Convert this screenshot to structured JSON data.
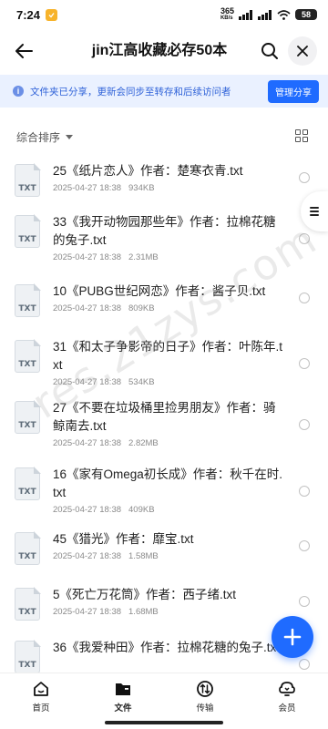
{
  "status_bar": {
    "time": "7:24",
    "speed_top": "365",
    "speed_unit": "KB/s",
    "battery": "58"
  },
  "title_bar": {
    "title": "jin江高收藏必存50本"
  },
  "banner": {
    "text": "文件夹已分享，更新会同步至转存和后续访问者",
    "manage_label": "管理分享",
    "colors": {
      "background": "#eaf1ff",
      "text": "#2f62d8",
      "button": "#1f6bff"
    }
  },
  "toolbar": {
    "sort_label": "综合排序"
  },
  "files": [
    {
      "ext": "TXT",
      "name": "25《纸片恋人》作者：楚寒衣青.txt",
      "date": "2025-04-27 18:38",
      "size": "934KB"
    },
    {
      "ext": "TXT",
      "name": "33《我开动物园那些年》作者：拉棉花糖的兔子.txt",
      "date": "2025-04-27 18:38",
      "size": "2.31MB"
    },
    {
      "ext": "TXT",
      "name": "10《PUBG世纪网恋》作者：酱子贝.txt",
      "date": "2025-04-27 18:38",
      "size": "809KB"
    },
    {
      "ext": "TXT",
      "name": "31《和太子争影帝的日子》作者：叶陈年.txt",
      "date": "2025-04-27 18:38",
      "size": "534KB"
    },
    {
      "ext": "TXT",
      "name": "27《不要在垃圾桶里捡男朋友》作者：骑鲸南去.txt",
      "date": "2025-04-27 18:38",
      "size": "2.82MB"
    },
    {
      "ext": "TXT",
      "name": "16《家有Omega初长成》作者：秋千在时.txt",
      "date": "2025-04-27 18:38",
      "size": "409KB"
    },
    {
      "ext": "TXT",
      "name": "45《猎光》作者：靡宝.txt",
      "date": "2025-04-27 18:38",
      "size": "1.58MB"
    },
    {
      "ext": "TXT",
      "name": "5《死亡万花筒》作者：西子绪.txt",
      "date": "2025-04-27 18:38",
      "size": "1.68MB"
    },
    {
      "ext": "TXT",
      "name": "36《我爱种田》作者：拉棉花糖的兔子.txt",
      "date": "",
      "size": ""
    }
  ],
  "watermark": "res.21zys.com",
  "tabs": [
    {
      "label": "首页",
      "icon": "home-icon"
    },
    {
      "label": "文件",
      "icon": "folder-icon"
    },
    {
      "label": "传输",
      "icon": "transfer-icon"
    },
    {
      "label": "会员",
      "icon": "member-icon"
    }
  ],
  "accent_color": "#1f6bff"
}
